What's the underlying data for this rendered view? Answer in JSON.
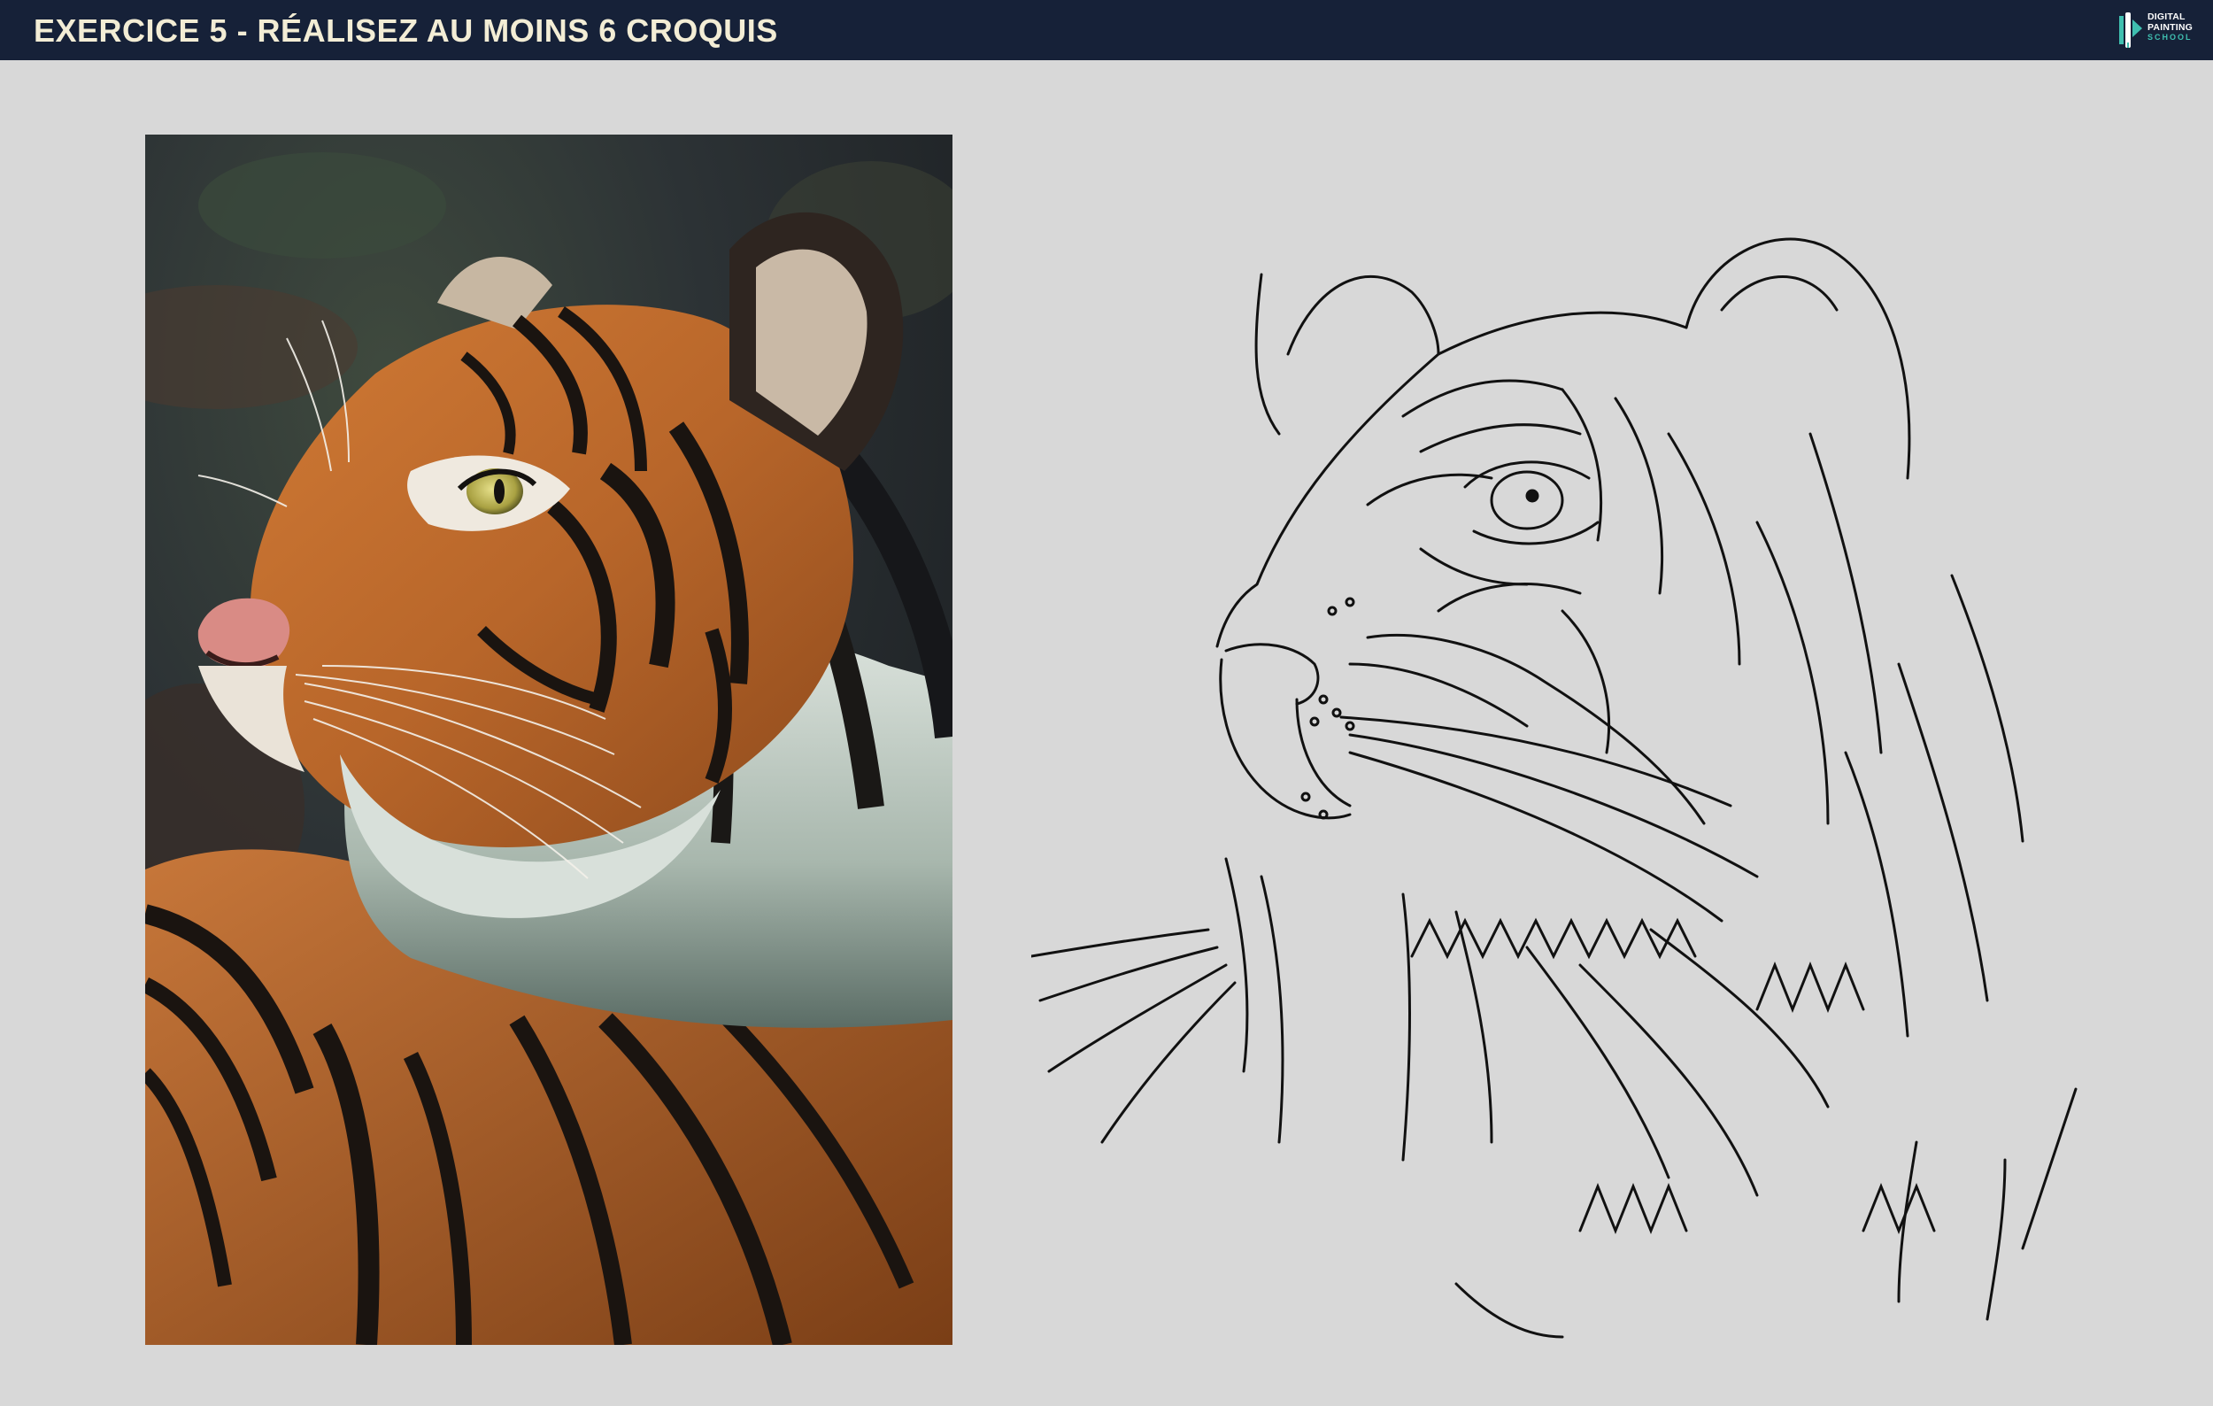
{
  "header": {
    "title": "EXERCICE 5 - RÉALISEZ AU MOINS 6 CROQUIS",
    "logo": {
      "line1": "DIGITAL",
      "line2": "PAINTING",
      "line3": "SCHOOL",
      "icon": "brush-logo-icon"
    }
  },
  "colors": {
    "header_bg": "#162138",
    "title": "#f3edd5",
    "page_bg": "#d8d8d8",
    "logo_accent": "#3fbfb0"
  }
}
